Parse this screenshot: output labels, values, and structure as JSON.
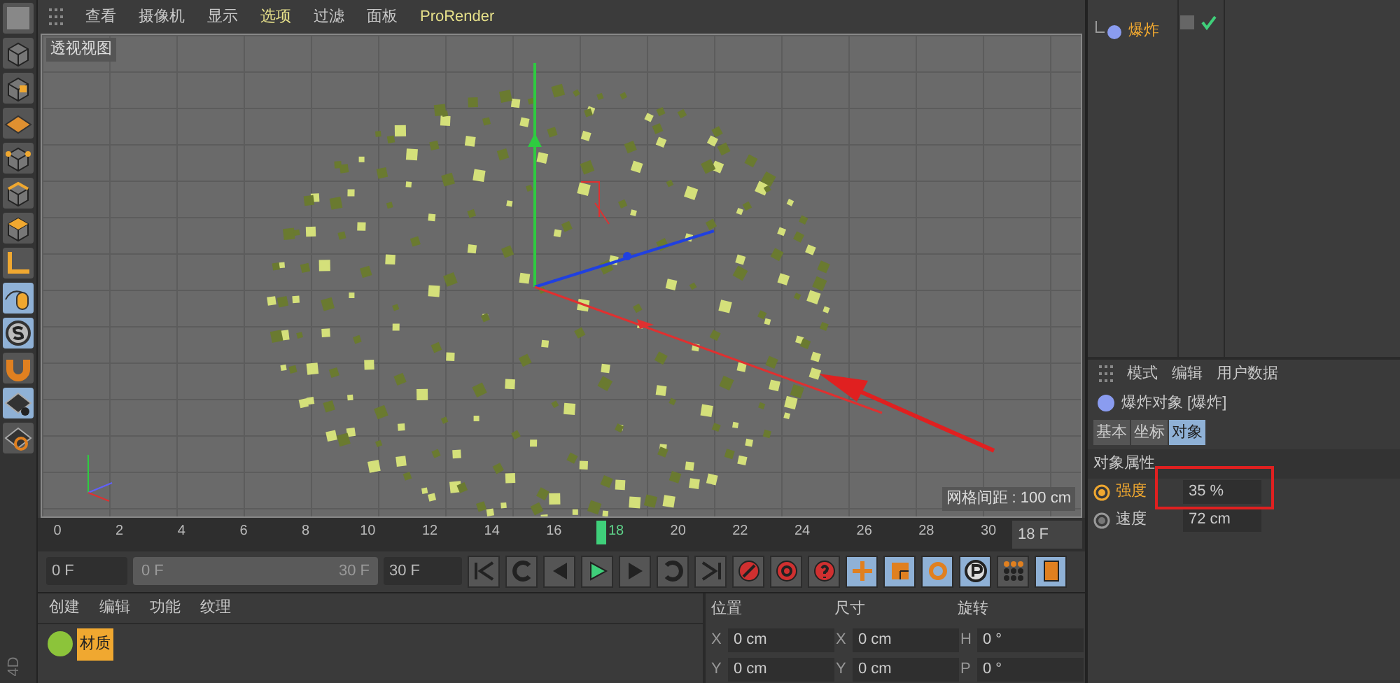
{
  "viewport": {
    "menu": [
      {
        "label": "查看",
        "selected": false
      },
      {
        "label": "摄像机",
        "selected": false
      },
      {
        "label": "显示",
        "selected": false
      },
      {
        "label": "选项",
        "selected": true
      },
      {
        "label": "过滤",
        "selected": false
      },
      {
        "label": "面板",
        "selected": false
      },
      {
        "label": "ProRender",
        "selected": true
      }
    ],
    "title": "透视视图",
    "grid_spacing": "网格间距 : 100 cm"
  },
  "object_manager": {
    "objects": [
      {
        "name": "爆炸"
      }
    ]
  },
  "attributes": {
    "menu": [
      "模式",
      "编辑",
      "用户数据"
    ],
    "object_title": "爆炸对象 [爆炸]",
    "tabs": [
      {
        "label": "基本",
        "selected": false
      },
      {
        "label": "坐标",
        "selected": false
      },
      {
        "label": "对象",
        "selected": true
      }
    ],
    "section": "对象属性",
    "params": [
      {
        "label": "强度",
        "value": "35 %",
        "selected": true
      },
      {
        "label": "速度",
        "value": "72 cm",
        "selected": false
      }
    ]
  },
  "timeline": {
    "ticks": [
      {
        "label": "0",
        "selected": false
      },
      {
        "label": "2",
        "selected": false
      },
      {
        "label": "4",
        "selected": false
      },
      {
        "label": "6",
        "selected": false
      },
      {
        "label": "8",
        "selected": false
      },
      {
        "label": "10",
        "selected": false
      },
      {
        "label": "12",
        "selected": false
      },
      {
        "label": "14",
        "selected": false
      },
      {
        "label": "16",
        "selected": false
      },
      {
        "label": "18",
        "selected": true
      },
      {
        "label": "20",
        "selected": false
      },
      {
        "label": "22",
        "selected": false
      },
      {
        "label": "24",
        "selected": false
      },
      {
        "label": "26",
        "selected": false
      },
      {
        "label": "28",
        "selected": false
      },
      {
        "label": "30",
        "selected": false
      }
    ],
    "current_frame": "18 F",
    "start": "0 F",
    "range": {
      "start": "0 F",
      "end": "30 F",
      "level": 1
    },
    "end": "30 F"
  },
  "material_manager": {
    "menu": [
      "创建",
      "编辑",
      "功能",
      "纹理"
    ],
    "materials": [
      "材质"
    ]
  },
  "coordinates": {
    "headers": [
      "位置",
      "尺寸",
      "旋转"
    ],
    "rows": [
      {
        "cells": [
          {
            "axis": "X",
            "value": "0 cm"
          },
          {
            "axis": "X",
            "value": "0 cm"
          },
          {
            "axis": "H",
            "value": "0 °"
          }
        ]
      },
      {
        "cells": [
          {
            "axis": "Y",
            "value": "0 cm"
          },
          {
            "axis": "Y",
            "value": "0 cm"
          },
          {
            "axis": "P",
            "value": "0 °"
          }
        ]
      }
    ]
  },
  "logo_text": "4D"
}
